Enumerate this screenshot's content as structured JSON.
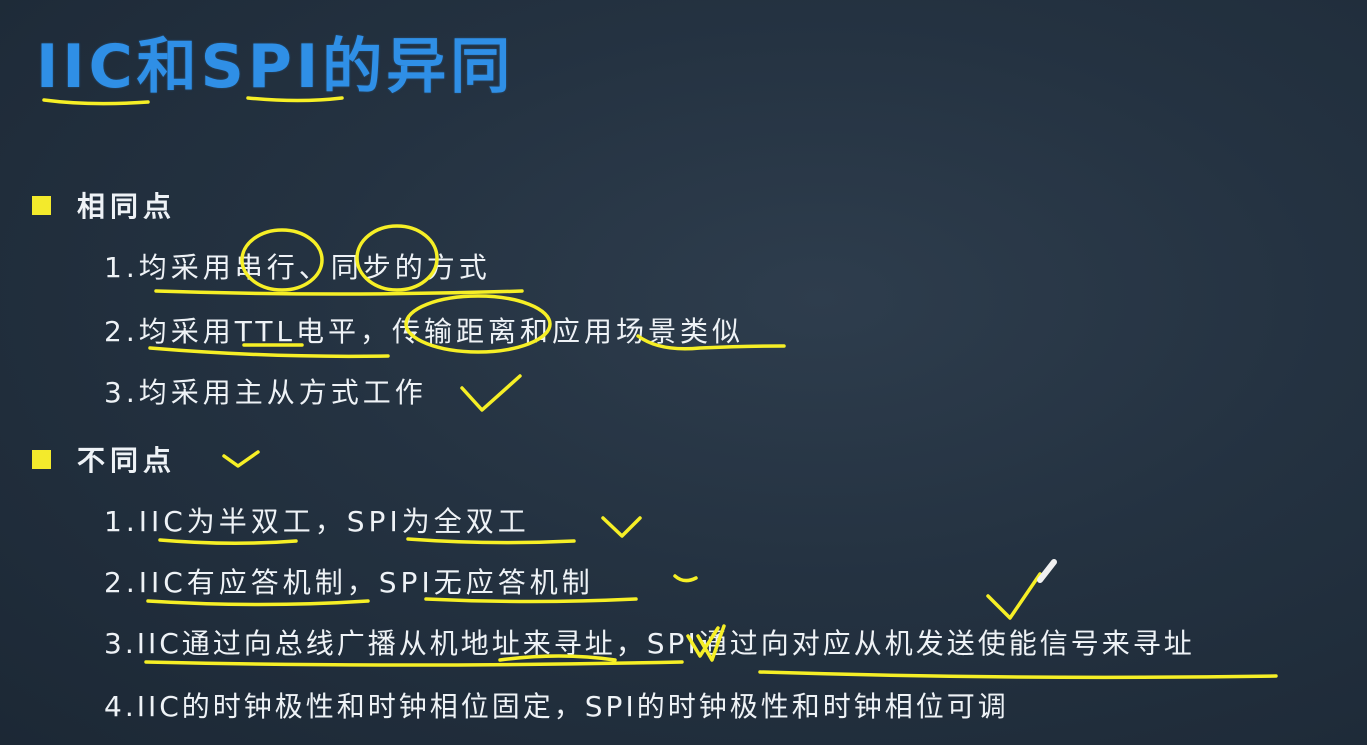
{
  "slide": {
    "title": "IIC和SPI的异同",
    "sections": [
      {
        "label": "相同点",
        "items": [
          "1.均采用串行、同步的方式",
          "2.均采用TTL电平，传输距离和应用场景类似",
          "3.均采用主从方式工作"
        ]
      },
      {
        "label": "不同点",
        "items": [
          "1.IIC为半双工，SPI为全双工",
          "2.IIC有应答机制，SPI无应答机制",
          "3.IIC通过向总线广播从机地址来寻址，SPI通过向对应从机发送使能信号来寻址",
          "4.IIC的时钟极性和时钟相位固定，SPI的时钟极性和时钟相位可调"
        ]
      }
    ]
  },
  "colors": {
    "title": "#2f8fe6",
    "bullet": "#f3ea2c",
    "text": "#eef2f6",
    "annotation": "#f6ef26",
    "background": "#243241"
  }
}
